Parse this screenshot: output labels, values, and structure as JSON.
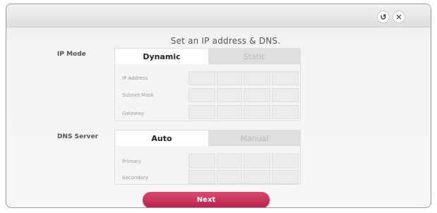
{
  "dialog": {
    "title": "Set an IP address & DNS.",
    "back_icon": "↺",
    "close_icon": "✕"
  },
  "ip_mode": {
    "label": "IP Mode",
    "tabs": [
      {
        "label": "Dynamic",
        "selected": true
      },
      {
        "label": "Static",
        "selected": false
      }
    ],
    "fields": [
      {
        "label": "IP Address"
      },
      {
        "label": "Subnet Mask"
      },
      {
        "label": "Gateway"
      }
    ]
  },
  "dns_server": {
    "label": "DNS Server",
    "tabs": [
      {
        "label": "Auto",
        "selected": true
      },
      {
        "label": "Manual",
        "selected": false
      }
    ],
    "fields": [
      {
        "label": "Primary"
      },
      {
        "label": "Secondary"
      }
    ]
  },
  "next_button": {
    "label": "Next"
  },
  "colors": {
    "accent": "#c0305a"
  }
}
